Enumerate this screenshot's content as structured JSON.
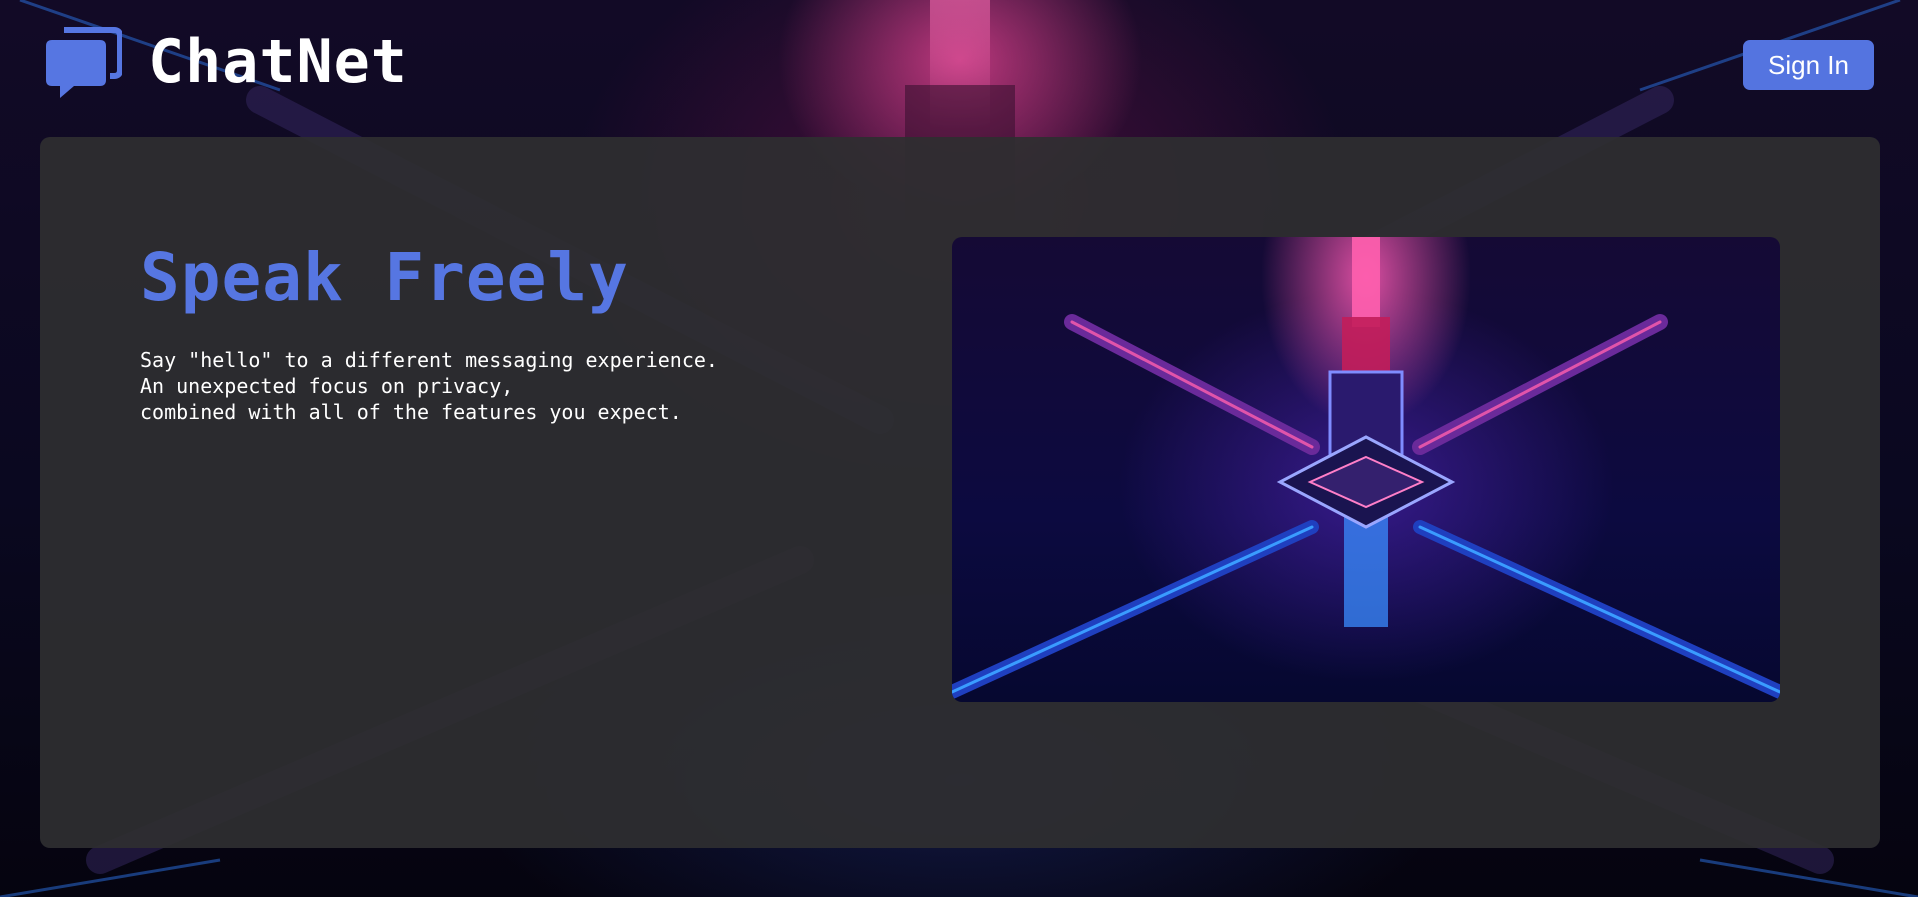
{
  "brand": {
    "name": "ChatNet",
    "icon": "chat-bubbles-icon"
  },
  "header": {
    "signin_label": "Sign In"
  },
  "hero": {
    "title": "Speak Freely",
    "lines": [
      "Say \"hello\" to a different messaging experience.",
      "An unexpected focus on privacy,",
      "combined with all of the features you expect."
    ],
    "image": "neon-crystal-artwork"
  },
  "colors": {
    "accent": "#5474e0",
    "panel": "#2e2e30",
    "text": "#ffffff",
    "page_background": "#07051a"
  }
}
